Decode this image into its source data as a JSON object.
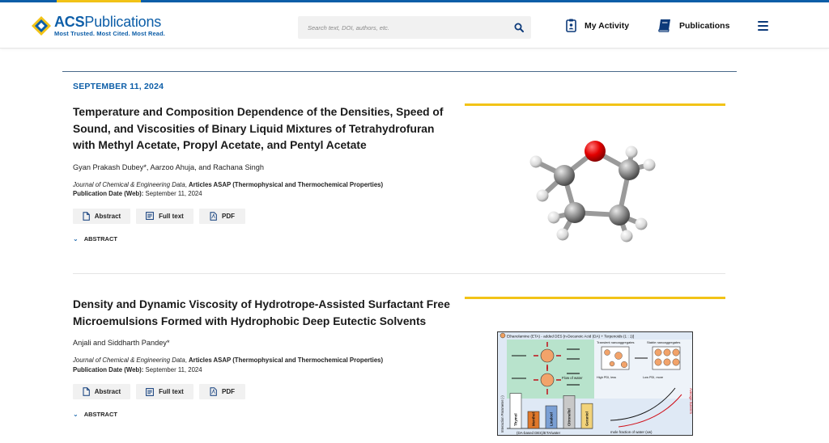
{
  "header": {
    "logo_name": "ACS",
    "logo_name_suffix": "Publications",
    "logo_tagline": "Most Trusted. Most Cited. Most Read.",
    "search_placeholder": "Search text, DOI, authors, etc.",
    "nav_activity": "My Activity",
    "nav_publications": "Publications",
    "colors": {
      "brand": "#0d5ea8",
      "accent": "#f2c317"
    }
  },
  "date": "SEPTEMBER 11, 2024",
  "articles": [
    {
      "title": "Temperature and Composition Dependence of the Densities, Speed of Sound, and Viscosities of Binary Liquid Mixtures of Tetrahydrofuran with Methyl Acetate, Propyl Acetate, and Pentyl Acetate",
      "authors": "Gyan Prakash Dubey*, Aarzoo Ahuja, and Rachana Singh",
      "journal": "Journal of Chemical & Engineering Data",
      "section": "Articles ASAP (Thermophysical and Thermochemical Properties)",
      "pubdate_label": "Publication Date (Web):",
      "pubdate": "September 11, 2024",
      "btn_abstract": "Abstract",
      "btn_fulltext": "Full text",
      "btn_pdf": "PDF",
      "abstract_toggle": "ABSTRACT"
    },
    {
      "title": "Density and Dynamic Viscosity of Hydrotrope-Assisted Surfactant Free Microemulsions Formed with Hydrophobic Deep Eutectic Solvents",
      "authors": "Anjali and Siddharth Pandey*",
      "journal": "Journal of Chemical & Engineering Data",
      "section": "Articles ASAP (Thermophysical and Thermochemical Properties)",
      "pubdate_label": "Publication Date (Web):",
      "pubdate": "September 11, 2024",
      "btn_abstract": "Abstract",
      "btn_fulltext": "Full text",
      "btn_pdf": "PDF",
      "abstract_toggle": "ABSTRACT"
    }
  ],
  "toc_graphic_2": {
    "header": "Ethanolamine (ETA) - added DES [n-Decanoic Acid (DA) + Terpenoids (1 : 1)]",
    "transient": "Transient nanoaggregates",
    "stable": "Stable nanoaggregates",
    "high_pdi": "High PDI, less",
    "low_pdi": "Low PDI, more",
    "flow": "Flow of water",
    "y_axis": "Interaction Parameter (-)",
    "x_axis_left": "(DA-based DES)/ETA/water",
    "x_axis_right": "mole fraction of water (xw)",
    "avg_size": "Average Size/nm",
    "bars": [
      "Thymol",
      "Menthol",
      "Linalool",
      "Citronellol",
      "Geraniol"
    ],
    "bar_colors": [
      "#ffffff",
      "#e0782a",
      "#7a9fd4",
      "#c8c8c8",
      "#f2d37a"
    ],
    "bar_heights": [
      0.62,
      0.3,
      0.4,
      0.58,
      0.44
    ]
  }
}
